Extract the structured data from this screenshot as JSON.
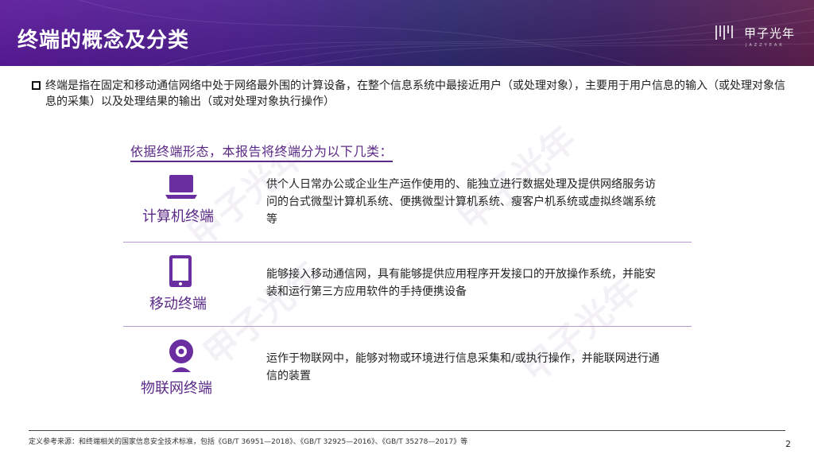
{
  "header": {
    "title": "终端的概念及分类"
  },
  "logo": {
    "name": "甲子光年",
    "sub": "JAZZYEAR"
  },
  "intro": {
    "text": "终端是指在固定和移动通信网络中处于网络最外围的计算设备，在整个信息系统中最接近用户（或处理对象），主要用于用户信息的输入（或处理对象信息的采集）以及处理结果的输出（或对处理对象执行操作）"
  },
  "classification": {
    "subtitle": "依据终端形态，本报告将终端分为以下几类：",
    "categories": [
      {
        "icon": "laptop-icon",
        "label": "计算机终端",
        "description": "供个人日常办公或企业生产运作使用的、能独立进行数据处理及提供网络服务访问的台式微型计算机系统、便携微型计算机系统、瘦客户机系统或虚拟终端系统等"
      },
      {
        "icon": "tablet-icon",
        "label": "移动终端",
        "description": "能够接入移动通信网，具有能够提供应用程序开发接口的开放操作系统，并能安装和运行第三方应用软件的手持便携设备"
      },
      {
        "icon": "webcam-icon",
        "label": "物联网终端",
        "description": "运作于物联网中，能够对物或环境进行信息采集和/或执行操作，并能联网进行通信的装置"
      }
    ]
  },
  "footer": {
    "note": "定义参考来源：和终端相关的国家信息安全技术标准，包括《GB/T 36951—2018》、《GB/T 32925—2016》、《GB/T 35278—2017》等",
    "page": "2"
  },
  "colors": {
    "accent": "#5b2a86",
    "header_start": "#5b1a9a",
    "header_end": "#5e1f4e",
    "icon": "#6a2ea0"
  }
}
